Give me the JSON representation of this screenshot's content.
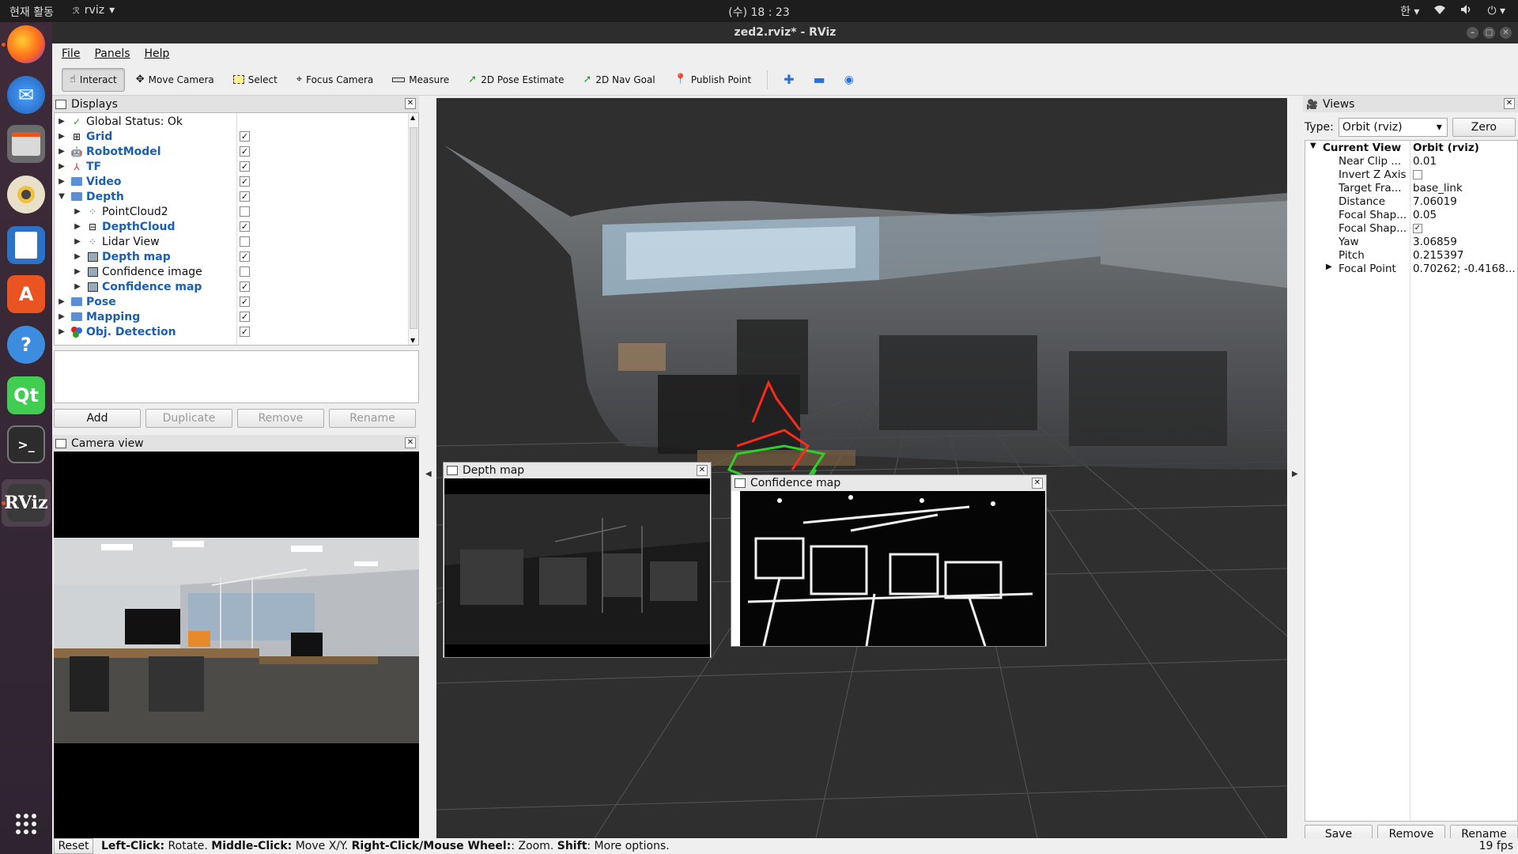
{
  "topbar": {
    "activities": "현재 활동",
    "app_name": "rviz",
    "clock": "(수) 18 : 23",
    "input_method": "한"
  },
  "window": {
    "title": "zed2.rviz* - RViz"
  },
  "menu": {
    "file": "File",
    "panels": "Panels",
    "help": "Help"
  },
  "toolbar": {
    "interact": "Interact",
    "move_camera": "Move Camera",
    "select": "Select",
    "focus_camera": "Focus Camera",
    "measure": "Measure",
    "pose_estimate": "2D Pose Estimate",
    "nav_goal": "2D Nav Goal",
    "publish_point": "Publish Point"
  },
  "displays": {
    "title": "Displays",
    "items": [
      {
        "label": "Global Status: Ok",
        "checked": null
      },
      {
        "label": "Grid",
        "checked": true
      },
      {
        "label": "RobotModel",
        "checked": true
      },
      {
        "label": "TF",
        "checked": true
      },
      {
        "label": "Video",
        "checked": true
      },
      {
        "label": "Depth",
        "checked": true
      },
      {
        "label": "PointCloud2",
        "checked": false
      },
      {
        "label": "DepthCloud",
        "checked": true
      },
      {
        "label": "Lidar View",
        "checked": false
      },
      {
        "label": "Depth map",
        "checked": true
      },
      {
        "label": "Confidence image",
        "checked": false
      },
      {
        "label": "Confidence map",
        "checked": true
      },
      {
        "label": "Pose",
        "checked": true
      },
      {
        "label": "Mapping",
        "checked": true
      },
      {
        "label": "Obj. Detection",
        "checked": true
      }
    ],
    "buttons": {
      "add": "Add",
      "duplicate": "Duplicate",
      "remove": "Remove",
      "rename": "Rename"
    }
  },
  "camera_view": {
    "title": "Camera view"
  },
  "depth_map": {
    "title": "Depth map"
  },
  "confidence_map": {
    "title": "Confidence map"
  },
  "views": {
    "title": "Views",
    "type_label": "Type:",
    "type_value": "Orbit (rviz)",
    "zero": "Zero",
    "current_view": {
      "key": "Current View",
      "value": "Orbit (rviz)"
    },
    "props": [
      {
        "key": "Near Clip ...",
        "value": "0.01"
      },
      {
        "key": "Invert Z Axis",
        "value": ""
      },
      {
        "key": "Target Fra...",
        "value": "base_link"
      },
      {
        "key": "Distance",
        "value": "7.06019"
      },
      {
        "key": "Focal Shap...",
        "value": "0.05"
      },
      {
        "key": "Focal Shap...",
        "value": ""
      },
      {
        "key": "Yaw",
        "value": "3.06859"
      },
      {
        "key": "Pitch",
        "value": "0.215397"
      },
      {
        "key": "Focal Point",
        "value": "0.70262; -0.4168..."
      }
    ],
    "buttons": {
      "save": "Save",
      "remove": "Remove",
      "rename": "Rename"
    }
  },
  "statusbar": {
    "reset": "Reset",
    "hint_bold_1": "Left-Click:",
    "hint_1": " Rotate. ",
    "hint_bold_2": "Middle-Click:",
    "hint_2": " Move X/Y. ",
    "hint_bold_3": "Right-Click/Mouse Wheel:",
    "hint_3": ": Zoom. ",
    "hint_bold_4": "Shift",
    "hint_4": ": More options.",
    "fps": "19 fps"
  }
}
